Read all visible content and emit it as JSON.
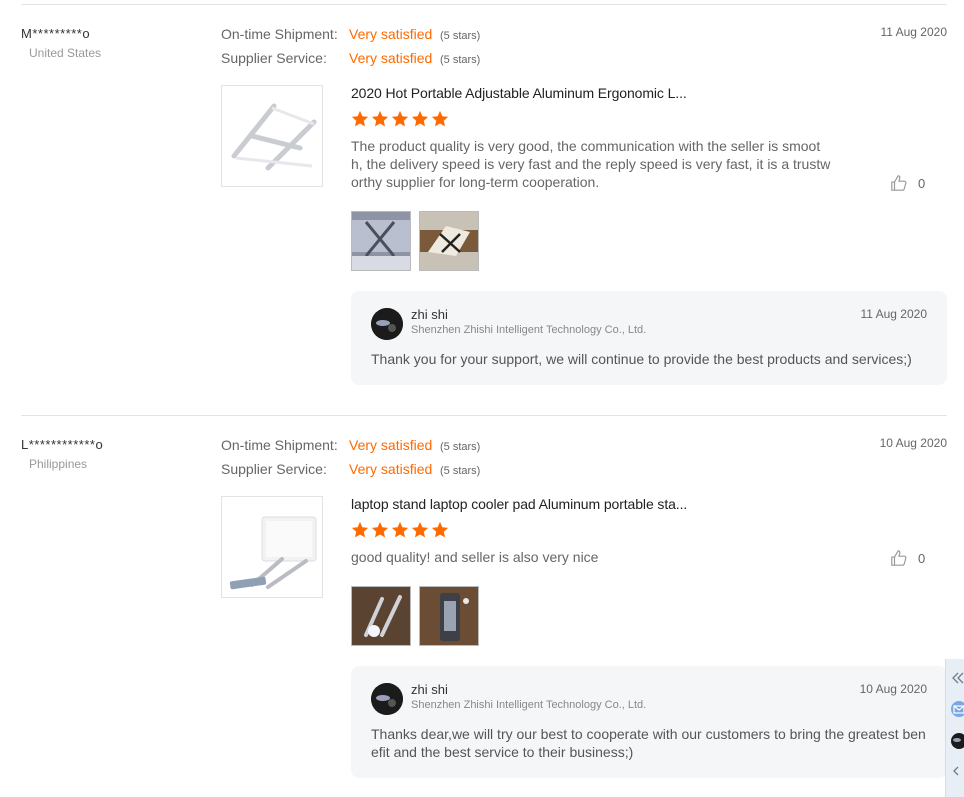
{
  "reviews": [
    {
      "buyer": "M*********o",
      "country": "United States",
      "shipment_label": "On-time Shipment:",
      "shipment_value": "Very satisfied",
      "shipment_stars": "(5 stars)",
      "service_label": "Supplier Service:",
      "service_value": "Very satisfied",
      "service_stars": "(5 stars)",
      "date": "11 Aug 2020",
      "product_title": "2020 Hot Portable Adjustable Aluminum Ergonomic L...",
      "rating": 5,
      "text": "The product quality is very good, the communication with the seller is smooth, the delivery speed is very fast and the reply speed is very fast, it is a trustworthy supplier for long-term cooperation.",
      "likes": "0",
      "reply": {
        "name": "zhi shi",
        "company": "Shenzhen Zhishi Intelligent Technology Co., Ltd.",
        "date": "11 Aug 2020",
        "text": "Thank you for your support, we will continue to provide the best products and services;)"
      }
    },
    {
      "buyer": "L************o",
      "country": "Philippines",
      "shipment_label": "On-time Shipment:",
      "shipment_value": "Very satisfied",
      "shipment_stars": "(5 stars)",
      "service_label": "Supplier Service:",
      "service_value": "Very satisfied",
      "service_stars": "(5 stars)",
      "date": "10 Aug 2020",
      "product_title": "laptop stand laptop cooler pad Aluminum portable sta...",
      "rating": 5,
      "text": "good quality! and seller is also very nice",
      "likes": "0",
      "reply": {
        "name": "zhi shi",
        "company": "Shenzhen Zhishi Intelligent Technology Co., Ltd.",
        "date": "10 Aug 2020",
        "text": "Thanks dear,we will try our best to cooperate with our customers to bring the greatest benefit and the best service to their business;)"
      }
    }
  ],
  "colors": {
    "accent": "#ff6a00",
    "reply_bg": "#f5f6f8"
  },
  "icons": [
    "thumbs-up-icon",
    "star-icon",
    "collapse-icon",
    "message-icon",
    "chevron-left-icon"
  ]
}
